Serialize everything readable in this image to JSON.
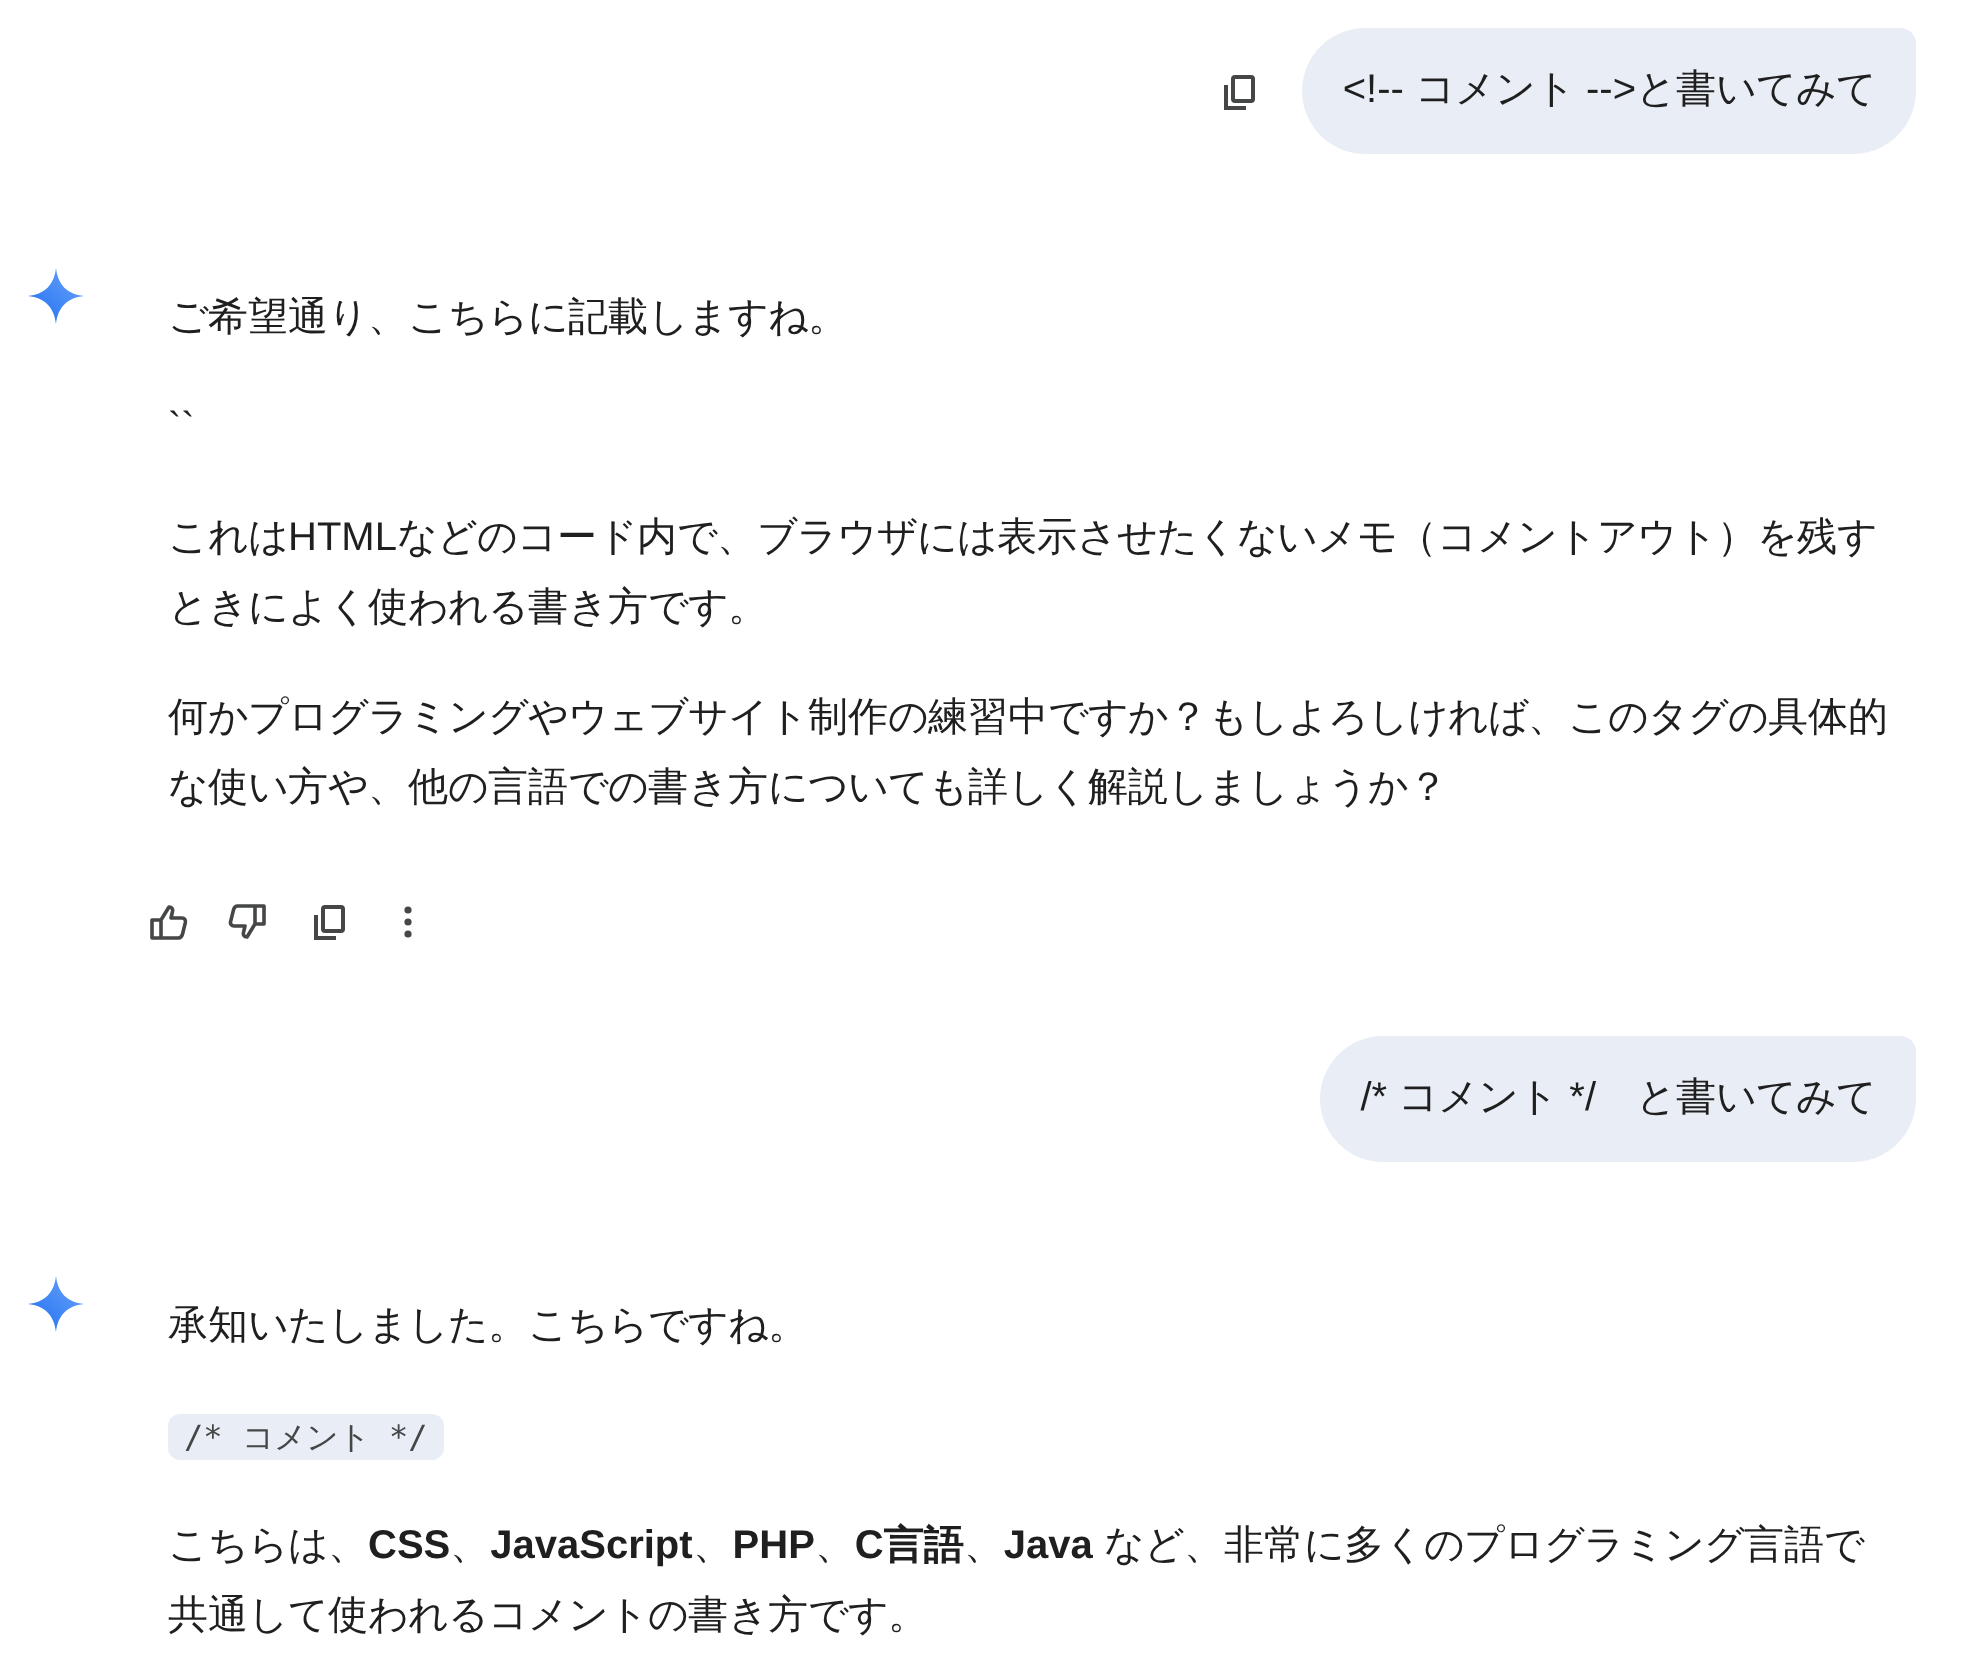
{
  "conversation": [
    {
      "kind": "user",
      "text": "<!-- コメント -->と書いてみて",
      "copy_button": true
    },
    {
      "kind": "model",
      "blocks": [
        {
          "kind": "paragraph",
          "text": "ご希望通り、こちらに記載しますね。"
        },
        {
          "kind": "paragraph",
          "text": "``"
        },
        {
          "kind": "paragraph",
          "text": "これはHTMLなどのコード内で、ブラウザには表示させたくないメモ（コメントアウト）を残すときによく使われる書き方です。"
        },
        {
          "kind": "paragraph",
          "text": "何かプログラミングやウェブサイト制作の練習中ですか？もしよろしければ、このタグの具体的な使い方や、他の言語での書き方についても詳しく解説しましょうか？"
        }
      ],
      "action_bar": true
    },
    {
      "kind": "user",
      "text": "/* コメント */　と書いてみて",
      "copy_button": false
    },
    {
      "kind": "model",
      "blocks": [
        {
          "kind": "paragraph",
          "text": "承知いたしました。こちらですね。"
        },
        {
          "kind": "code",
          "text": "/* コメント */"
        },
        {
          "kind": "paragraph",
          "text": "こちらは、**CSS**、**JavaScript**、**PHP**、**C言語**、**Java** など、非常に多くのプログラミング言語で共通して使われるコメントの書き方です。"
        }
      ],
      "action_bar": false
    }
  ]
}
